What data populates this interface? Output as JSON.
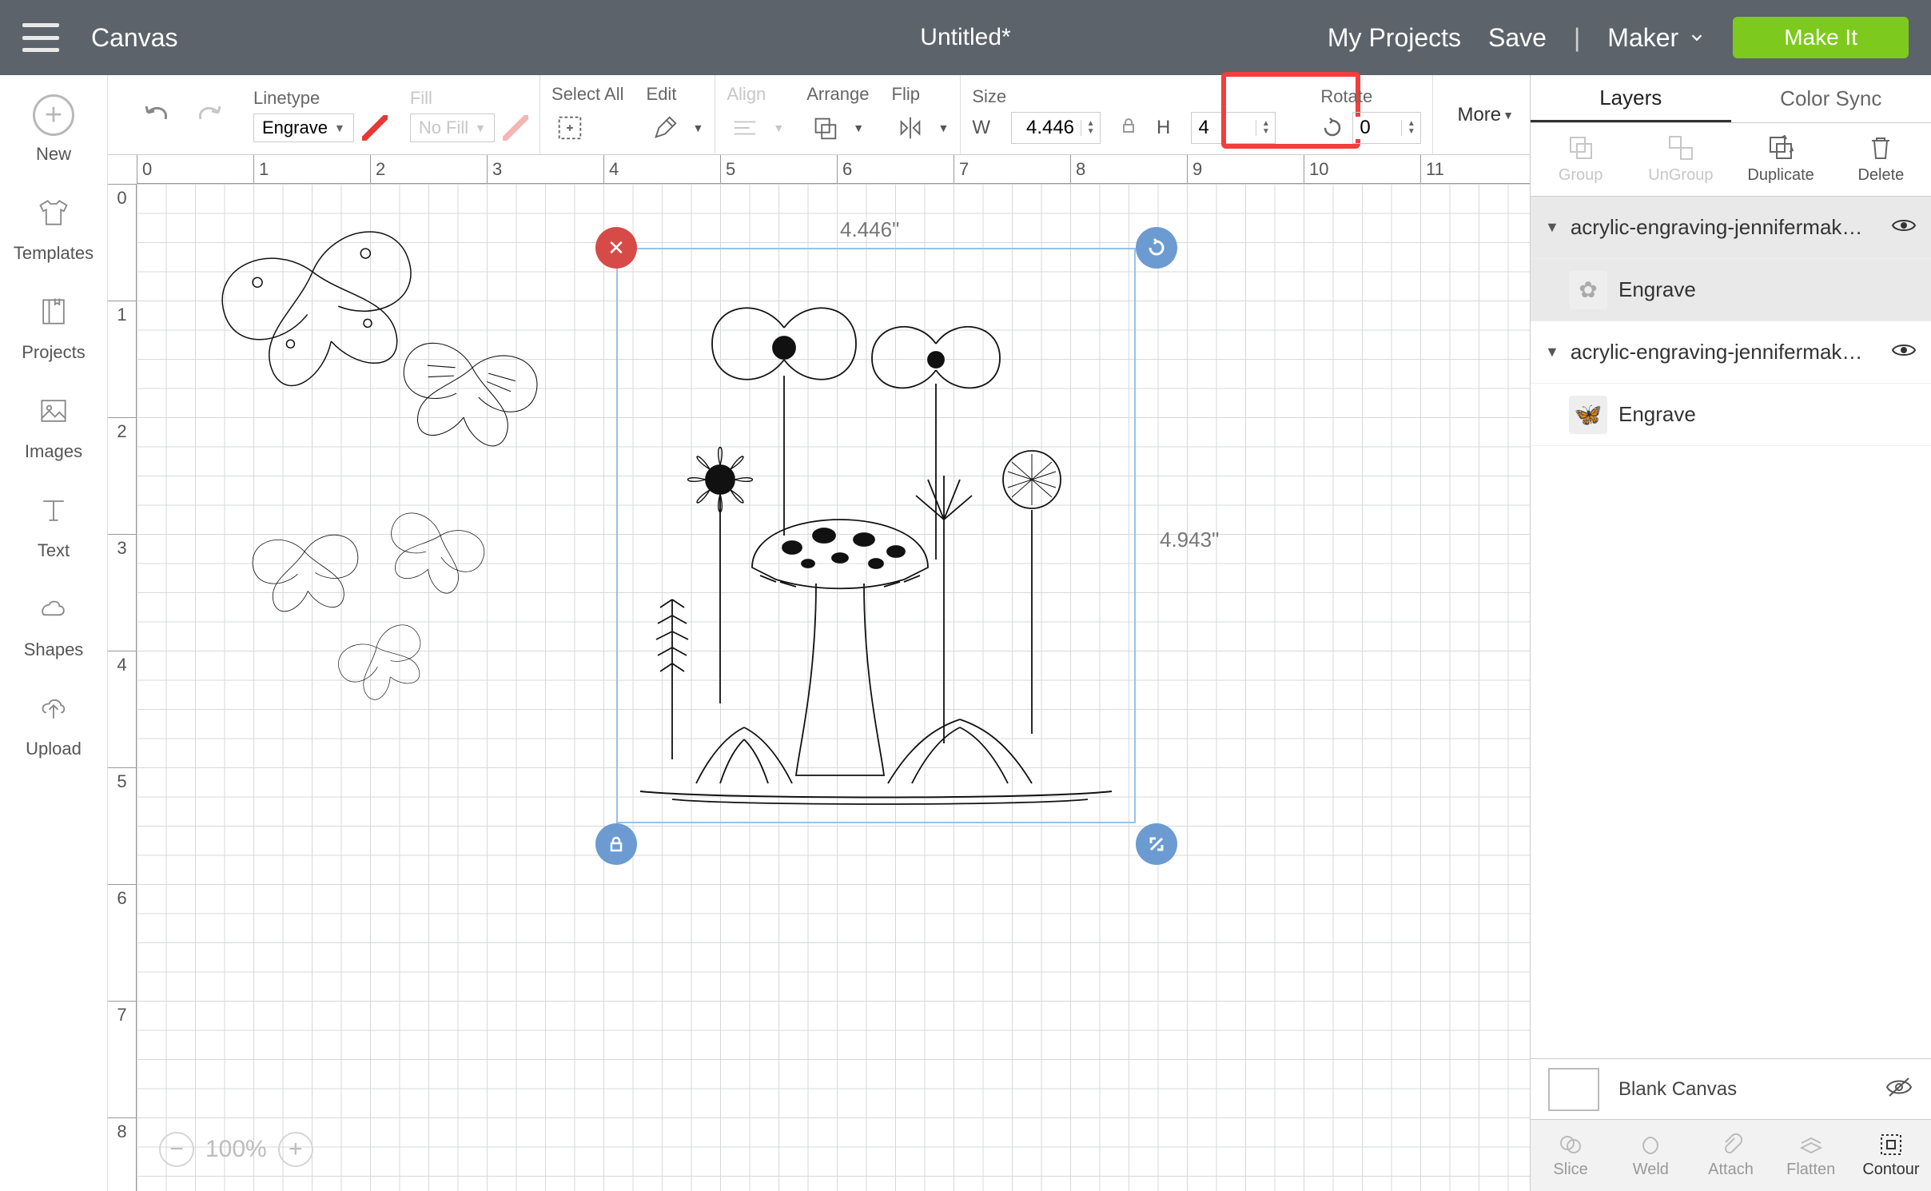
{
  "header": {
    "app_title": "Canvas",
    "doc_title": "Untitled*",
    "my_projects": "My Projects",
    "save": "Save",
    "separator": "|",
    "machine": "Maker",
    "make_it": "Make It"
  },
  "left_sidebar": [
    {
      "label": "New",
      "icon": "plus"
    },
    {
      "label": "Templates",
      "icon": "shirt"
    },
    {
      "label": "Projects",
      "icon": "book"
    },
    {
      "label": "Images",
      "icon": "image"
    },
    {
      "label": "Text",
      "icon": "text"
    },
    {
      "label": "Shapes",
      "icon": "shapes"
    },
    {
      "label": "Upload",
      "icon": "upload"
    }
  ],
  "toolbar": {
    "linetype_label": "Linetype",
    "linetype_value": "Engrave",
    "fill_label": "Fill",
    "fill_value": "No Fill",
    "select_all": "Select All",
    "edit": "Edit",
    "align": "Align",
    "arrange": "Arrange",
    "flip": "Flip",
    "size": "Size",
    "w_label": "W",
    "w_value": "4.446",
    "h_label": "H",
    "h_value": "4",
    "rotate": "Rotate",
    "rotate_value": "0",
    "more": "More"
  },
  "right_panel": {
    "tabs": {
      "layers": "Layers",
      "color_sync": "Color Sync"
    },
    "actions": {
      "group": "Group",
      "ungroup": "UnGroup",
      "duplicate": "Duplicate",
      "delete": "Delete"
    },
    "layers": [
      {
        "name": "acrylic-engraving-jennifermak…",
        "sublabel": "Engrave",
        "selected": true
      },
      {
        "name": "acrylic-engraving-jennifermak…",
        "sublabel": "Engrave",
        "selected": false
      }
    ],
    "footer_label": "Blank Canvas",
    "bottom": {
      "slice": "Slice",
      "weld": "Weld",
      "attach": "Attach",
      "flatten": "Flatten",
      "contour": "Contour"
    }
  },
  "canvas": {
    "ruler_h": [
      "0",
      "1",
      "2",
      "3",
      "4",
      "5",
      "6",
      "7",
      "8",
      "9",
      "10",
      "11"
    ],
    "ruler_v": [
      "0",
      "1",
      "2",
      "3",
      "4",
      "5",
      "6",
      "7",
      "8"
    ],
    "selection": {
      "w_label": "4.446\"",
      "h_label": "4.943\""
    },
    "zoom": "100%"
  }
}
